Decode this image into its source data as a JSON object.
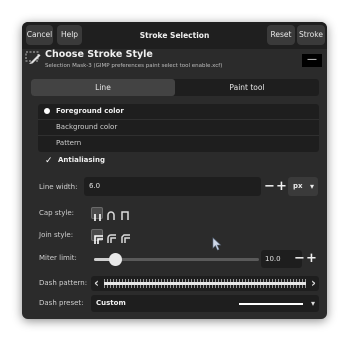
{
  "titlebar": {
    "title": "Stroke Selection",
    "cancel_label": "Cancel",
    "help_label": "Help",
    "reset_label": "Reset",
    "stroke_label": "Stroke"
  },
  "header": {
    "title": "Choose Stroke Style",
    "subtitle": "Selection Mask-3 (GIMP preferences paint select tool enable.xcf)",
    "close_glyph": "—"
  },
  "tabs": [
    {
      "label": "Line",
      "active": true
    },
    {
      "label": "Paint tool",
      "active": false
    }
  ],
  "fill_options": [
    {
      "label": "Foreground color",
      "selected": true
    },
    {
      "label": "Background color",
      "selected": false
    },
    {
      "label": "Pattern",
      "selected": false
    }
  ],
  "antialiasing": {
    "label": "Antialiasing",
    "checked": true
  },
  "line_width": {
    "label": "Line width:",
    "value": "6.0",
    "unit": "px"
  },
  "cap_style": {
    "label": "Cap style:",
    "options": [
      "butt",
      "round",
      "square"
    ],
    "selected": 0
  },
  "join_style": {
    "label": "Join style:",
    "options": [
      "miter",
      "round",
      "bevel"
    ],
    "selected": 0
  },
  "miter_limit": {
    "label": "Miter limit:",
    "value": "10.0",
    "slider_fraction": 0.1
  },
  "dash_pattern": {
    "label": "Dash pattern:"
  },
  "dash_preset": {
    "label": "Dash preset:",
    "value": "Custom"
  },
  "colors": {
    "background": "#2b2b2b",
    "titlebar": "#1f1f1f",
    "field": "#1e1e1e",
    "button": "#3a3a3a"
  },
  "glyphs": {
    "minus": "−",
    "plus": "+",
    "check": "✓",
    "dropdown": "▾",
    "left": "‹",
    "right": "›"
  }
}
